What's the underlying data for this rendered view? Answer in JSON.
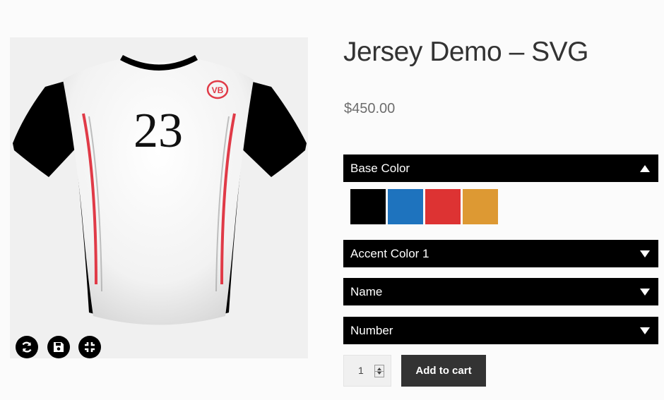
{
  "product": {
    "title": "Jersey Demo – SVG",
    "price": "$450.00"
  },
  "jersey": {
    "number": "23",
    "logo_text": "VB",
    "colors": {
      "base": "#ffffff",
      "sleeve": "#000000",
      "accent": "#e03a47"
    }
  },
  "preview_controls": [
    {
      "icon": "refresh-icon"
    },
    {
      "icon": "save-icon"
    },
    {
      "icon": "compress-icon"
    }
  ],
  "sections": {
    "base_color": {
      "label": "Base Color",
      "expanded": true
    },
    "accent_color": {
      "label": "Accent Color 1",
      "expanded": false
    },
    "name": {
      "label": "Name",
      "expanded": false
    },
    "number": {
      "label": "Number",
      "expanded": false
    }
  },
  "swatches": [
    {
      "name": "black",
      "color": "#000000"
    },
    {
      "name": "blue",
      "color": "#1e73be"
    },
    {
      "name": "red",
      "color": "#dd3333"
    },
    {
      "name": "orange",
      "color": "#dd9933"
    }
  ],
  "quantity": {
    "value": "1"
  },
  "add_to_cart": {
    "label": "Add to cart"
  }
}
